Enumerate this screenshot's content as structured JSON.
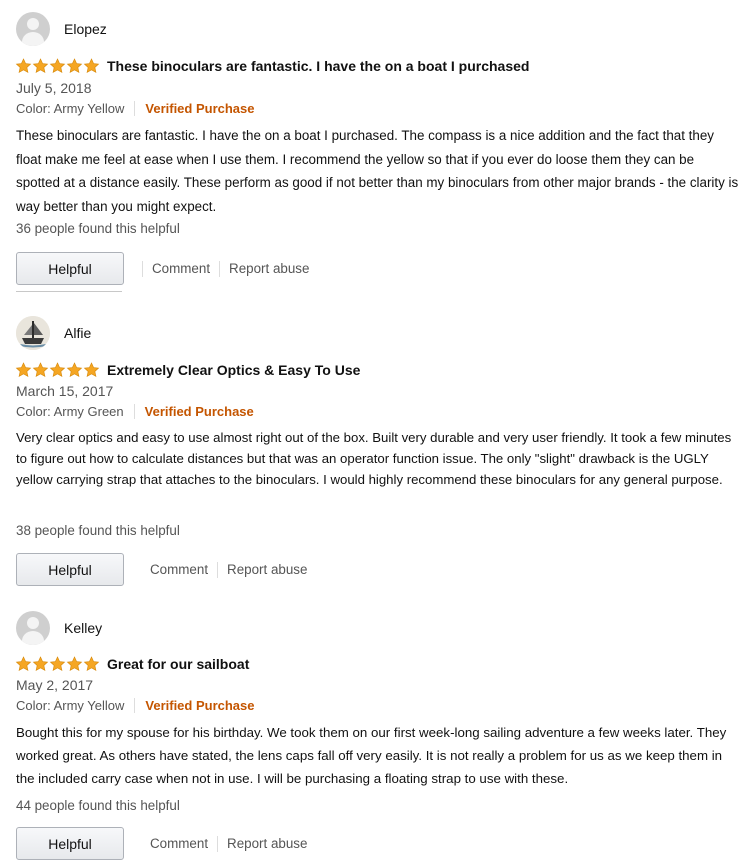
{
  "reviews": [
    {
      "reviewer": "Elopez",
      "avatar": "default-avatar-icon",
      "stars": 5,
      "title": "These binoculars are fantastic. I have the on a boat I purchased",
      "date": "July 5, 2018",
      "variant": "Color: Army Yellow",
      "verified": "Verified Purchase",
      "body": "These binoculars are fantastic. I have the on a boat I purchased. The compass is a nice addition and the fact that they float make me feel at ease when I use them. I recommend the yellow so that if you ever do loose them they can be spotted at a distance easily. These perform as good if not better than my binoculars from other major brands - the clarity is way better than you might expect.",
      "helpful_count": "36 people found this helpful",
      "helpful_label": "Helpful",
      "comment_label": "Comment",
      "report_label": "Report abuse"
    },
    {
      "reviewer": "Alfie",
      "avatar": "ship-avatar-icon",
      "stars": 5,
      "title": "Extremely Clear Optics & Easy To Use",
      "date": "March 15, 2017",
      "variant": "Color: Army Green",
      "verified": "Verified Purchase",
      "body": "Very clear optics and easy to use almost right out of the box. Built very durable and very user friendly. It took a few minutes to figure out how to calculate distances but that was an operator function issue. The only \"slight\" drawback is the UGLY yellow carrying strap that attaches to the binoculars. I would highly recommend these binoculars for any general purpose.",
      "helpful_count": "38 people found this helpful",
      "helpful_label": "Helpful",
      "comment_label": "Comment",
      "report_label": "Report abuse"
    },
    {
      "reviewer": "Kelley",
      "avatar": "default-avatar-icon",
      "stars": 5,
      "title": "Great for our sailboat",
      "date": "May 2, 2017",
      "variant": "Color: Army Yellow",
      "verified": "Verified Purchase",
      "body": "Bought this for my spouse for his birthday. We took them on our first week-long sailing adventure a few weeks later. They worked great. As others have stated, the lens caps fall off very easily. It is not really a problem for us as we keep them in the included carry case when not in use. I will be purchasing a floating strap to use with these.",
      "helpful_count": "44 people found this helpful",
      "helpful_label": "Helpful",
      "comment_label": "Comment",
      "report_label": "Report abuse"
    }
  ],
  "colors": {
    "star": "#f5a623",
    "verified": "#c45500",
    "muted_text": "#555555"
  }
}
